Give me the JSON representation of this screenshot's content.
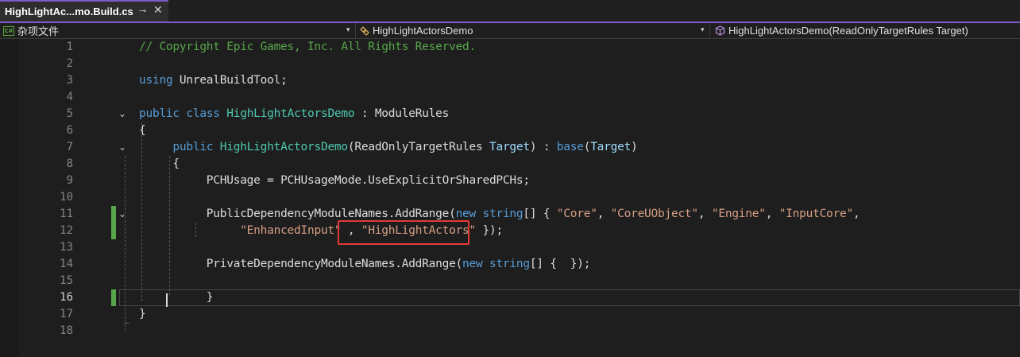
{
  "tab": {
    "title": "HighLightAc...mo.Build.cs",
    "pin_glyph": "⊸",
    "close_glyph": "✕"
  },
  "navbar": {
    "project": "杂项文件",
    "project_icon_text": "C#",
    "type": "HighLightActorsDemo",
    "member": "HighLightActorsDemo(ReadOnlyTargetRules Target)",
    "dropdown_glyph": "▾"
  },
  "editor": {
    "current_line": 16,
    "lines": [
      {
        "num": "1",
        "segments": [
          {
            "t": "// Copyright Epic Games, Inc. All Rights Reserved.",
            "c": "c-comment"
          }
        ]
      },
      {
        "num": "2",
        "segments": []
      },
      {
        "num": "3",
        "segments": [
          {
            "t": "using",
            "c": "c-kw"
          },
          {
            "t": " UnrealBuildTool;",
            "c": ""
          }
        ]
      },
      {
        "num": "4",
        "segments": []
      },
      {
        "num": "5",
        "segments": [
          {
            "t": "public",
            "c": "c-kw"
          },
          {
            "t": " ",
            "c": ""
          },
          {
            "t": "class",
            "c": "c-kw"
          },
          {
            "t": " ",
            "c": ""
          },
          {
            "t": "HighLightActorsDemo",
            "c": "c-type"
          },
          {
            "t": " : ModuleRules",
            "c": ""
          }
        ]
      },
      {
        "num": "6",
        "segments": [
          {
            "t": "{",
            "c": ""
          }
        ]
      },
      {
        "num": "7",
        "segments": [
          {
            "t": "     ",
            "c": ""
          },
          {
            "t": "public",
            "c": "c-kw"
          },
          {
            "t": " ",
            "c": ""
          },
          {
            "t": "HighLightActorsDemo",
            "c": "c-type"
          },
          {
            "t": "(ReadOnlyTargetRules ",
            "c": ""
          },
          {
            "t": "Target",
            "c": "c-param"
          },
          {
            "t": ") : ",
            "c": ""
          },
          {
            "t": "base",
            "c": "c-kw"
          },
          {
            "t": "(",
            "c": ""
          },
          {
            "t": "Target",
            "c": "c-param"
          },
          {
            "t": ")",
            "c": ""
          }
        ]
      },
      {
        "num": "8",
        "segments": [
          {
            "t": "     {",
            "c": ""
          }
        ]
      },
      {
        "num": "9",
        "segments": [
          {
            "t": "          PCHUsage = PCHUsageMode.UseExplicitOrSharedPCHs;",
            "c": ""
          }
        ]
      },
      {
        "num": "10",
        "segments": []
      },
      {
        "num": "11",
        "segments": [
          {
            "t": "          PublicDependencyModuleNames.AddRange(",
            "c": ""
          },
          {
            "t": "new",
            "c": "c-kw"
          },
          {
            "t": " ",
            "c": ""
          },
          {
            "t": "string",
            "c": "c-kw"
          },
          {
            "t": "[] { ",
            "c": ""
          },
          {
            "t": "\"Core\"",
            "c": "c-str"
          },
          {
            "t": ", ",
            "c": ""
          },
          {
            "t": "\"CoreUObject\"",
            "c": "c-str"
          },
          {
            "t": ", ",
            "c": ""
          },
          {
            "t": "\"Engine\"",
            "c": "c-str"
          },
          {
            "t": ", ",
            "c": ""
          },
          {
            "t": "\"InputCore\"",
            "c": "c-str"
          },
          {
            "t": ",",
            "c": ""
          }
        ]
      },
      {
        "num": "12",
        "segments": [
          {
            "t": "               ",
            "c": ""
          },
          {
            "t": "\"EnhancedInput\"",
            "c": "c-str"
          },
          {
            "t": " , ",
            "c": ""
          },
          {
            "t": "\"HighLightActors\"",
            "c": "c-str"
          },
          {
            "t": " });",
            "c": ""
          }
        ]
      },
      {
        "num": "13",
        "segments": []
      },
      {
        "num": "14",
        "segments": [
          {
            "t": "          PrivateDependencyModuleNames.AddRange(",
            "c": ""
          },
          {
            "t": "new",
            "c": "c-kw"
          },
          {
            "t": " ",
            "c": ""
          },
          {
            "t": "string",
            "c": "c-kw"
          },
          {
            "t": "[] {  });",
            "c": ""
          }
        ]
      },
      {
        "num": "15",
        "segments": []
      },
      {
        "num": "16",
        "segments": [
          {
            "t": "          }",
            "c": ""
          }
        ]
      },
      {
        "num": "17",
        "segments": [
          {
            "t": "}",
            "c": ""
          }
        ]
      },
      {
        "num": "18",
        "segments": []
      }
    ],
    "folds": [
      5,
      7,
      11
    ],
    "changed_lines": [
      11,
      12,
      16
    ],
    "highlighted_token": "\"HighLightActors\""
  },
  "colors": {
    "accent": "#7a5cc6",
    "comment": "#57a64a",
    "keyword": "#569cd6",
    "type": "#4ec9b0",
    "string": "#d69d85",
    "highlight_box": "#e53935"
  }
}
